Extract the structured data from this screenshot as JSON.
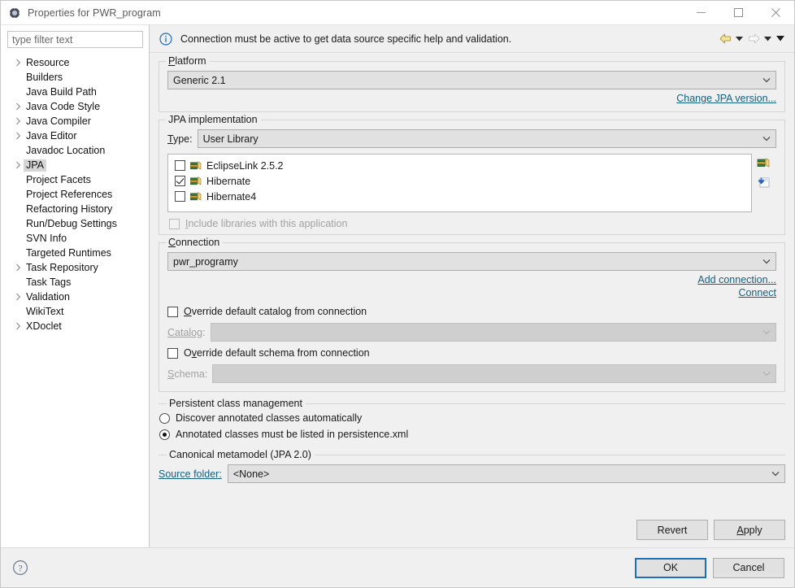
{
  "window": {
    "title": "Properties for PWR_program",
    "icon": "gear-icon",
    "minimize_label": "Minimize",
    "maximize_label": "Maximize",
    "close_label": "Close"
  },
  "sidebar": {
    "filter_placeholder": "type filter text",
    "filter_value": "",
    "items": [
      {
        "label": "Resource",
        "expandable": true,
        "selected": false
      },
      {
        "label": "Builders",
        "expandable": false,
        "selected": false
      },
      {
        "label": "Java Build Path",
        "expandable": false,
        "selected": false
      },
      {
        "label": "Java Code Style",
        "expandable": true,
        "selected": false
      },
      {
        "label": "Java Compiler",
        "expandable": true,
        "selected": false
      },
      {
        "label": "Java Editor",
        "expandable": true,
        "selected": false
      },
      {
        "label": "Javadoc Location",
        "expandable": false,
        "selected": false
      },
      {
        "label": "JPA",
        "expandable": true,
        "selected": true
      },
      {
        "label": "Project Facets",
        "expandable": false,
        "selected": false
      },
      {
        "label": "Project References",
        "expandable": false,
        "selected": false
      },
      {
        "label": "Refactoring History",
        "expandable": false,
        "selected": false
      },
      {
        "label": "Run/Debug Settings",
        "expandable": false,
        "selected": false
      },
      {
        "label": "SVN Info",
        "expandable": false,
        "selected": false
      },
      {
        "label": "Targeted Runtimes",
        "expandable": false,
        "selected": false
      },
      {
        "label": "Task Repository",
        "expandable": true,
        "selected": false
      },
      {
        "label": "Task Tags",
        "expandable": false,
        "selected": false
      },
      {
        "label": "Validation",
        "expandable": true,
        "selected": false
      },
      {
        "label": "WikiText",
        "expandable": false,
        "selected": false
      },
      {
        "label": "XDoclet",
        "expandable": true,
        "selected": false
      }
    ]
  },
  "message_bar": {
    "icon": "info-icon",
    "text": "Connection must be active to get data source specific help and validation.",
    "back_label": "Back",
    "back_enabled": true,
    "forward_label": "Forward",
    "forward_enabled": false,
    "menu_label": "View Menu"
  },
  "platform": {
    "group_label": "Platform",
    "value": "Generic 2.1",
    "change_link": "Change JPA version..."
  },
  "jpa_implementation": {
    "group_label": "JPA implementation",
    "type_label": "Type:",
    "type_value": "User Library",
    "libraries": [
      {
        "label": "EclipseLink 2.5.2",
        "checked": false
      },
      {
        "label": "Hibernate",
        "checked": true
      },
      {
        "label": "Hibernate4",
        "checked": false
      }
    ],
    "include_libraries_label": "Include libraries with this application",
    "include_libraries_checked": false,
    "include_libraries_enabled": false,
    "tool_user_libraries": "user-libraries-icon",
    "tool_download_library": "download-library-icon"
  },
  "connection": {
    "group_label": "Connection",
    "value": "pwr_programy",
    "add_connection_link": "Add connection...",
    "connect_link": "Connect",
    "override_catalog_label": "Override default catalog from connection",
    "override_catalog_checked": false,
    "catalog_label": "Catalog:",
    "catalog_value": "",
    "catalog_enabled": false,
    "override_schema_label": "Override default schema from connection",
    "override_schema_checked": false,
    "schema_label": "Schema:",
    "schema_value": "",
    "schema_enabled": false
  },
  "persistent_class_management": {
    "group_label": "Persistent class management",
    "options": [
      {
        "label": "Discover annotated classes automatically",
        "selected": false
      },
      {
        "label": "Annotated classes must be listed in persistence.xml",
        "selected": true
      }
    ]
  },
  "canonical_metamodel": {
    "group_label": "Canonical metamodel (JPA 2.0)",
    "source_folder_label": "Source folder:",
    "source_folder_value": "<None>"
  },
  "buttons": {
    "revert": "Revert",
    "apply": "Apply",
    "ok": "OK",
    "cancel": "Cancel",
    "help": "help-icon"
  },
  "colors": {
    "accent_link": "#15607f",
    "focus_border": "#1d6fb8",
    "window_bg": "#f0f0f0",
    "control_bg": "#e1e1e1",
    "selection": "#d6d6d6"
  }
}
